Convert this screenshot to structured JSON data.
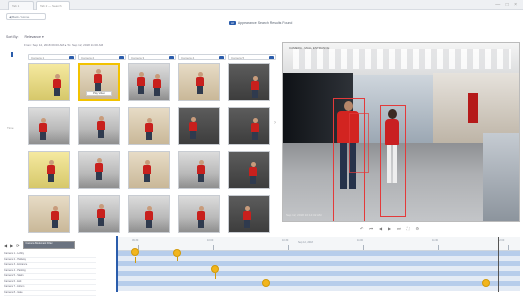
{
  "browser": {
    "tabs": [
      "Tab 1",
      "Tab 2 — Search"
    ],
    "window_controls": "— □ ×"
  },
  "toolbar": {
    "back_label": "◀ Back / Home",
    "banner_badge": "AI",
    "banner_text": "Appearance Search Results Found"
  },
  "search": {
    "sort_label": "Sort By:",
    "sort_value": "Relevance ▾",
    "date_range": "From: Sep 12, 2018 09:00 AM  ▸  To: Sep 12, 2018 11:00 AM",
    "camera_headers": [
      "Camera 1",
      "Camera 2",
      "Camera 3",
      "Camera 4",
      "Camera 5"
    ],
    "strip_label": "Time",
    "thumbnail_play_label": "Play Video"
  },
  "video": {
    "overlay_label": "CAMERA - MALL ENTRANCE",
    "timestamp": "Sep 12, 2018 10:14:32 AM",
    "controls": [
      "↶",
      "⏮",
      "◀",
      "▶",
      "⏭",
      "⛶",
      "⚙"
    ]
  },
  "timeline": {
    "toolbar_icons": [
      "◀",
      "▶",
      "⟳"
    ],
    "dropdown_value": "Camera Bookmark Filter",
    "center_label": "Sep 12, 2018",
    "tick_labels": [
      "09:30",
      "10:00",
      "10:30",
      "11:00",
      "11:30",
      "12:00"
    ],
    "track_labels": [
      "Camera 1 - Lobby",
      "Camera 2 - Hallway",
      "Camera 3 - Entrance",
      "Camera 4 - Parking",
      "Camera 5 - Stairs",
      "Camera 6 - Exit",
      "Camera 7 - Atrium",
      "Camera 8 - Gate",
      "Camera 9 - Mall"
    ]
  },
  "colors": {
    "accent": "#2a5cab",
    "marker": "#f2b51c",
    "bbox": "#e33a3a",
    "subject_shirt": "#d22420"
  }
}
